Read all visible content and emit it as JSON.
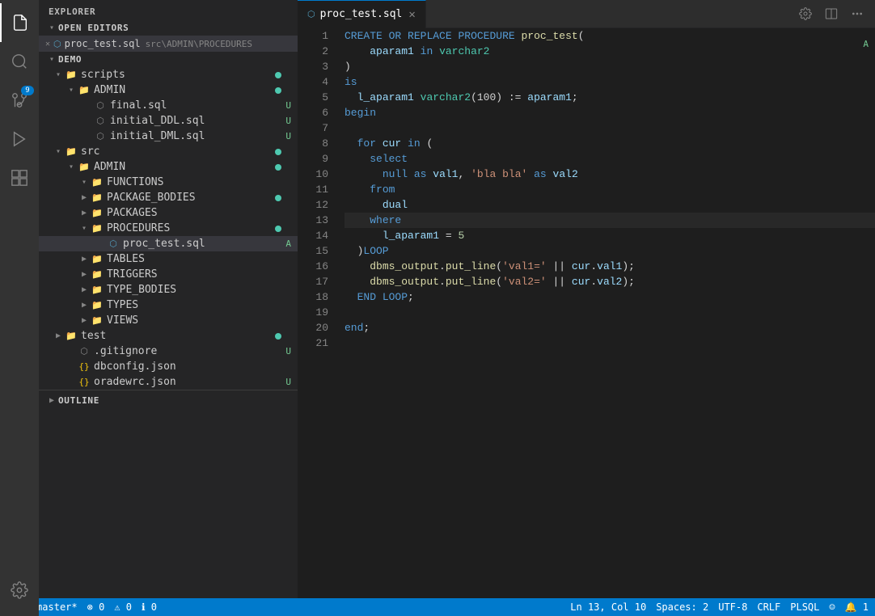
{
  "activityBar": {
    "icons": [
      {
        "name": "files-icon",
        "symbol": "⧉",
        "active": true,
        "badge": null
      },
      {
        "name": "search-icon",
        "symbol": "🔍",
        "active": false,
        "badge": null
      },
      {
        "name": "source-control-icon",
        "symbol": "⑂",
        "active": false,
        "badge": "9"
      },
      {
        "name": "debug-icon",
        "symbol": "▷",
        "active": false,
        "badge": null
      },
      {
        "name": "extensions-icon",
        "symbol": "⊞",
        "active": false,
        "badge": null
      }
    ],
    "bottomIcons": [
      {
        "name": "settings-icon",
        "symbol": "⚙"
      }
    ]
  },
  "sidebar": {
    "title": "EXPLORER",
    "sections": {
      "openEditors": {
        "label": "OPEN EDITORS",
        "items": [
          {
            "name": "proc_test.sql",
            "path": "src\\ADMIN\\PROCEDURES",
            "badge": "A"
          }
        ]
      },
      "demo": {
        "label": "DEMO",
        "items": [
          {
            "name": "scripts",
            "indent": 1,
            "expanded": true,
            "dot": "green",
            "children": [
              {
                "name": "ADMIN",
                "indent": 2,
                "expanded": true,
                "dot": "green",
                "children": [
                  {
                    "name": "final.sql",
                    "indent": 3,
                    "badge": "U",
                    "isFile": true
                  },
                  {
                    "name": "initial_DDL.sql",
                    "indent": 3,
                    "badge": "U",
                    "isFile": true
                  },
                  {
                    "name": "initial_DML.sql",
                    "indent": 3,
                    "badge": "U",
                    "isFile": true
                  }
                ]
              }
            ]
          },
          {
            "name": "src",
            "indent": 1,
            "expanded": true,
            "dot": "green",
            "children": [
              {
                "name": "ADMIN",
                "indent": 2,
                "expanded": true,
                "dot": "green",
                "children": [
                  {
                    "name": "FUNCTIONS",
                    "indent": 3,
                    "expanded": true
                  },
                  {
                    "name": "PACKAGE_BODIES",
                    "indent": 3,
                    "expanded": false,
                    "dot": "green"
                  },
                  {
                    "name": "PACKAGES",
                    "indent": 3,
                    "expanded": false
                  },
                  {
                    "name": "PROCEDURES",
                    "indent": 3,
                    "expanded": true,
                    "dot": "green",
                    "children": [
                      {
                        "name": "proc_test.sql",
                        "indent": 4,
                        "badge": "A",
                        "isFile": true,
                        "active": true
                      }
                    ]
                  },
                  {
                    "name": "TABLES",
                    "indent": 3,
                    "expanded": false
                  },
                  {
                    "name": "TRIGGERS",
                    "indent": 3,
                    "expanded": false
                  },
                  {
                    "name": "TYPE_BODIES",
                    "indent": 3,
                    "expanded": false
                  },
                  {
                    "name": "TYPES",
                    "indent": 3,
                    "expanded": false
                  },
                  {
                    "name": "VIEWS",
                    "indent": 3,
                    "expanded": false
                  }
                ]
              }
            ]
          },
          {
            "name": "test",
            "indent": 1,
            "dot": "green"
          },
          {
            "name": ".gitignore",
            "indent": 1,
            "isFile": true,
            "badge": "U"
          },
          {
            "name": "dbconfig.json",
            "indent": 1,
            "isFile": true
          },
          {
            "name": "oradewrc.json",
            "indent": 1,
            "isFile": true,
            "badge": "U"
          }
        ]
      }
    }
  },
  "editor": {
    "tabs": [
      {
        "label": "proc_test.sql",
        "active": true,
        "modified": false
      }
    ],
    "lines": [
      {
        "num": 1,
        "tokens": [
          {
            "t": "kw",
            "v": "CREATE"
          },
          {
            "t": "plain",
            "v": " "
          },
          {
            "t": "kw",
            "v": "OR"
          },
          {
            "t": "plain",
            "v": " "
          },
          {
            "t": "kw",
            "v": "REPLACE"
          },
          {
            "t": "plain",
            "v": " "
          },
          {
            "t": "kw",
            "v": "PROCEDURE"
          },
          {
            "t": "plain",
            "v": " "
          },
          {
            "t": "fn",
            "v": "proc_test"
          },
          {
            "t": "plain",
            "v": "("
          }
        ]
      },
      {
        "num": 2,
        "tokens": [
          {
            "t": "plain",
            "v": "    "
          },
          {
            "t": "var",
            "v": "aparam1"
          },
          {
            "t": "plain",
            "v": " "
          },
          {
            "t": "kw",
            "v": "in"
          },
          {
            "t": "plain",
            "v": " "
          },
          {
            "t": "type",
            "v": "varchar2"
          }
        ]
      },
      {
        "num": 3,
        "tokens": [
          {
            "t": "plain",
            "v": ")"
          }
        ]
      },
      {
        "num": 4,
        "tokens": [
          {
            "t": "kw",
            "v": "is"
          }
        ]
      },
      {
        "num": 5,
        "tokens": [
          {
            "t": "plain",
            "v": "  "
          },
          {
            "t": "var",
            "v": "l_aparam1"
          },
          {
            "t": "plain",
            "v": " "
          },
          {
            "t": "type",
            "v": "varchar2"
          },
          {
            "t": "plain",
            "v": "(100) := "
          },
          {
            "t": "var",
            "v": "aparam1"
          },
          {
            "t": "plain",
            "v": ";"
          }
        ]
      },
      {
        "num": 6,
        "tokens": [
          {
            "t": "kw",
            "v": "begin"
          }
        ]
      },
      {
        "num": 7,
        "tokens": []
      },
      {
        "num": 8,
        "tokens": [
          {
            "t": "plain",
            "v": "  "
          },
          {
            "t": "kw",
            "v": "for"
          },
          {
            "t": "plain",
            "v": " "
          },
          {
            "t": "var",
            "v": "cur"
          },
          {
            "t": "plain",
            "v": " "
          },
          {
            "t": "kw",
            "v": "in"
          },
          {
            "t": "plain",
            "v": " ("
          }
        ]
      },
      {
        "num": 9,
        "tokens": [
          {
            "t": "plain",
            "v": "    "
          },
          {
            "t": "kw",
            "v": "select"
          }
        ]
      },
      {
        "num": 10,
        "tokens": [
          {
            "t": "plain",
            "v": "      "
          },
          {
            "t": "kw",
            "v": "null"
          },
          {
            "t": "plain",
            "v": " "
          },
          {
            "t": "kw",
            "v": "as"
          },
          {
            "t": "plain",
            "v": " "
          },
          {
            "t": "var",
            "v": "val1"
          },
          {
            "t": "plain",
            "v": ", "
          },
          {
            "t": "str",
            "v": "'bla bla'"
          },
          {
            "t": "plain",
            "v": " "
          },
          {
            "t": "kw",
            "v": "as"
          },
          {
            "t": "plain",
            "v": " "
          },
          {
            "t": "var",
            "v": "val2"
          }
        ]
      },
      {
        "num": 11,
        "tokens": [
          {
            "t": "plain",
            "v": "    "
          },
          {
            "t": "kw",
            "v": "from"
          }
        ]
      },
      {
        "num": 12,
        "tokens": [
          {
            "t": "plain",
            "v": "      "
          },
          {
            "t": "var",
            "v": "dual"
          }
        ]
      },
      {
        "num": 13,
        "tokens": [
          {
            "t": "plain",
            "v": "    "
          },
          {
            "t": "kw",
            "v": "where"
          }
        ],
        "highlighted": true
      },
      {
        "num": 14,
        "tokens": [
          {
            "t": "plain",
            "v": "      "
          },
          {
            "t": "var",
            "v": "l_aparam1"
          },
          {
            "t": "plain",
            "v": " = "
          },
          {
            "t": "num",
            "v": "5"
          }
        ]
      },
      {
        "num": 15,
        "tokens": [
          {
            "t": "plain",
            "v": "  )"
          },
          {
            "t": "kw",
            "v": "LOOP"
          }
        ]
      },
      {
        "num": 16,
        "tokens": [
          {
            "t": "plain",
            "v": "    "
          },
          {
            "t": "fn",
            "v": "dbms_output"
          },
          {
            "t": "plain",
            "v": "."
          },
          {
            "t": "fn",
            "v": "put_line"
          },
          {
            "t": "plain",
            "v": "("
          },
          {
            "t": "str",
            "v": "'val1='"
          },
          {
            "t": "plain",
            "v": " || "
          },
          {
            "t": "var",
            "v": "cur"
          },
          {
            "t": "plain",
            "v": "."
          },
          {
            "t": "var",
            "v": "val1"
          },
          {
            "t": "plain",
            "v": ");"
          }
        ]
      },
      {
        "num": 17,
        "tokens": [
          {
            "t": "plain",
            "v": "    "
          },
          {
            "t": "fn",
            "v": "dbms_output"
          },
          {
            "t": "plain",
            "v": "."
          },
          {
            "t": "fn",
            "v": "put_line"
          },
          {
            "t": "plain",
            "v": "("
          },
          {
            "t": "str",
            "v": "'val2='"
          },
          {
            "t": "plain",
            "v": " || "
          },
          {
            "t": "var",
            "v": "cur"
          },
          {
            "t": "plain",
            "v": "."
          },
          {
            "t": "var",
            "v": "val2"
          },
          {
            "t": "plain",
            "v": ");"
          }
        ]
      },
      {
        "num": 18,
        "tokens": [
          {
            "t": "plain",
            "v": "  "
          },
          {
            "t": "kw",
            "v": "END"
          },
          {
            "t": "plain",
            "v": " "
          },
          {
            "t": "kw",
            "v": "LOOP"
          },
          {
            "t": "plain",
            "v": ";"
          }
        ]
      },
      {
        "num": 19,
        "tokens": []
      },
      {
        "num": 20,
        "tokens": [
          {
            "t": "kw",
            "v": "end"
          },
          {
            "t": "plain",
            "v": ";"
          }
        ]
      },
      {
        "num": 21,
        "tokens": []
      }
    ]
  },
  "statusBar": {
    "left": [
      {
        "id": "branch",
        "text": "⎇ master*"
      },
      {
        "id": "errors",
        "text": "⊗ 0"
      },
      {
        "id": "warnings",
        "text": "⚠ 0"
      },
      {
        "id": "info",
        "text": "ℹ 0"
      }
    ],
    "right": [
      {
        "id": "position",
        "text": "Ln 13, Col 10"
      },
      {
        "id": "spaces",
        "text": "Spaces: 2"
      },
      {
        "id": "encoding",
        "text": "UTF-8"
      },
      {
        "id": "eol",
        "text": "CRLF"
      },
      {
        "id": "language",
        "text": "PLSQL"
      },
      {
        "id": "smiley",
        "text": "☺"
      },
      {
        "id": "notifications",
        "text": "🔔 1"
      }
    ]
  },
  "outline": {
    "label": "OUTLINE"
  }
}
